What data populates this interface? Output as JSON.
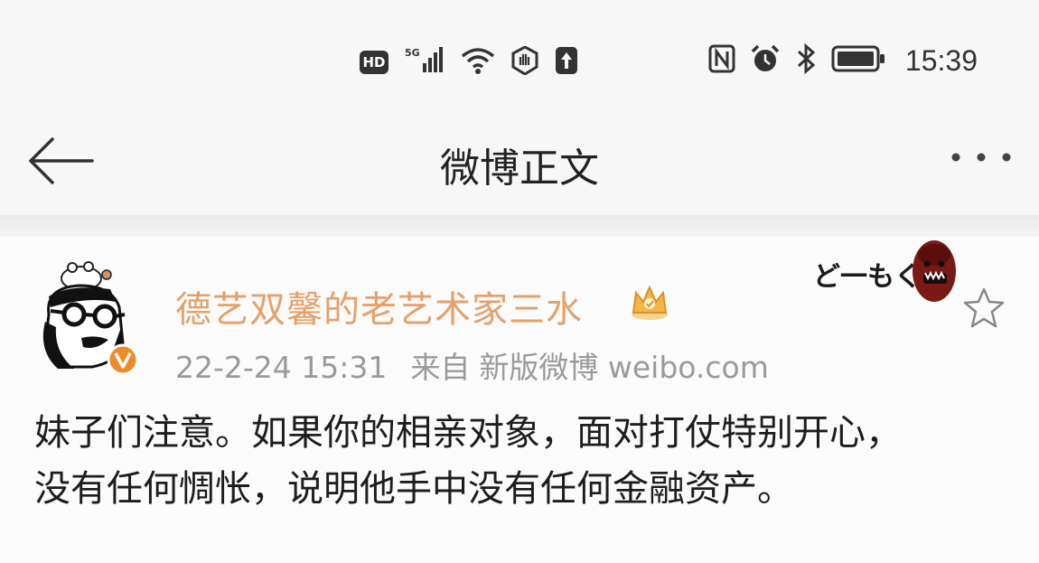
{
  "status_bar": {
    "hd_label": "HD",
    "network_label": "5G",
    "time": "15:39",
    "icons": [
      "hd-icon",
      "signal-5g-icon",
      "wifi-icon",
      "hand-stop-icon",
      "upload-icon",
      "nfc-icon",
      "alarm-icon",
      "bluetooth-icon",
      "battery-icon"
    ]
  },
  "nav": {
    "title": "微博正文",
    "back_icon": "arrow-left-icon",
    "more_icon": "more-dots-icon"
  },
  "post": {
    "username": "德艺双馨的老艺术家三水",
    "username_color": "#e6a06a",
    "badge_icon": "crown-icon",
    "verified_icon": "verified-v-icon",
    "timestamp": "22-2-24 15:31",
    "source_prefix": "来自",
    "source": "新版微博 weibo.com",
    "sticker_text": "ど一もく",
    "favorite_icon": "star-outline-icon",
    "content_lines": [
      "妹子们注意。如果你的相亲对象，面对打仗特别开心，",
      "没有任何惆怅，说明他手中没有任何金融资产。"
    ]
  }
}
